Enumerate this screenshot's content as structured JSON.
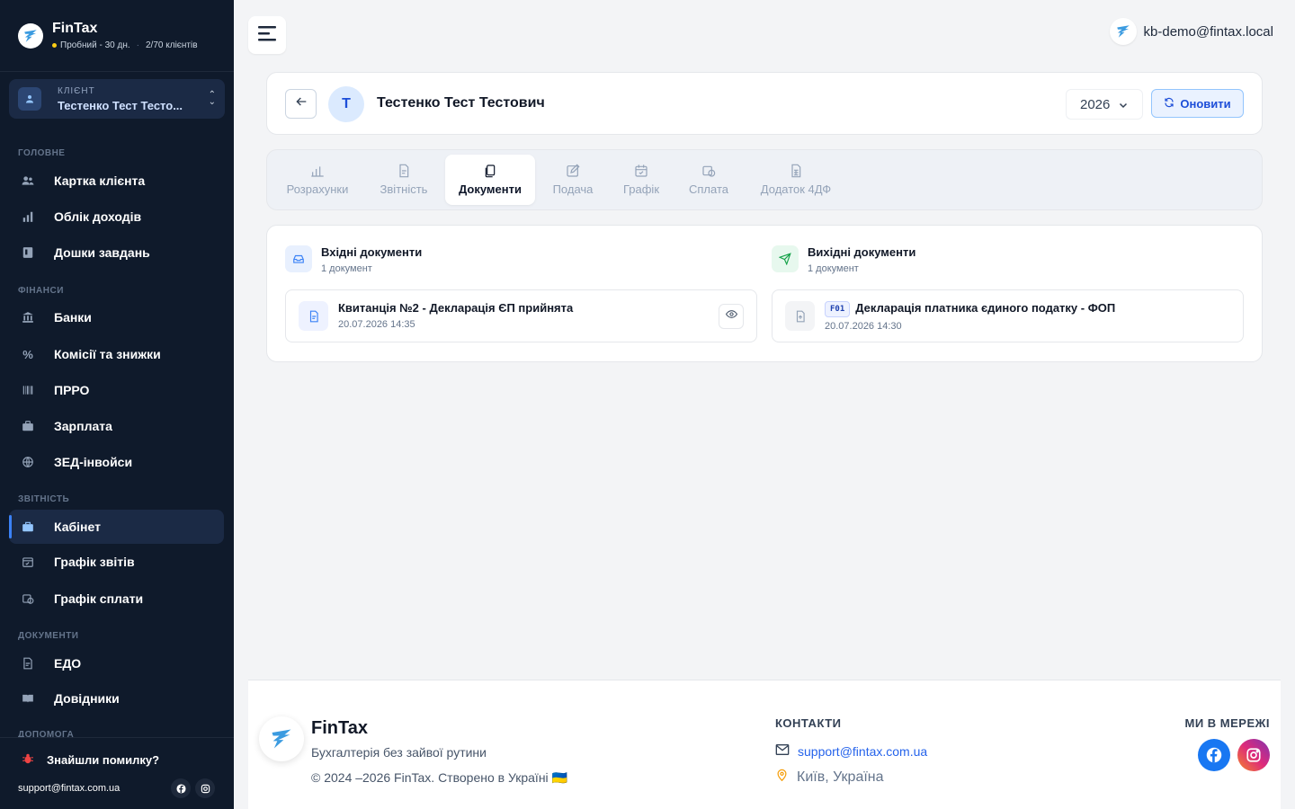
{
  "brand": {
    "name": "FinTax",
    "trial": "Пробний - 30 дн.",
    "separator": "·",
    "clients": "2/70 клієнтів"
  },
  "client_selector": {
    "kicker": "КЛІЄНТ",
    "name": "Тестенко Тест Тесто..."
  },
  "sidebar": {
    "sections": {
      "main": "ГОЛОВНЕ",
      "finance": "ФІНАНСИ",
      "reporting": "ЗВІТНІСТЬ",
      "documents": "ДОКУМЕНТИ",
      "help": "ДОПОМОГА"
    },
    "items": {
      "client_card": "Картка клієнта",
      "income": "Облік доходів",
      "boards": "Дошки завдань",
      "banks": "Банки",
      "commissions": "Комісії та знижки",
      "prro": "ПРРО",
      "salary": "Зарплата",
      "zed": "ЗЕД-інвойси",
      "cabinet": "Кабінет",
      "report_schedule": "Графік звітів",
      "payment_schedule": "Графік сплати",
      "edo": "ЕДО",
      "references": "Довідники"
    },
    "bug_report": "Знайшли помилку?",
    "support_email": "support@fintax.com.ua"
  },
  "topbar": {
    "user_email": "kb-demo@fintax.local"
  },
  "header": {
    "avatar_letter": "Т",
    "client_full_name": "Тестенко Тест Тестович",
    "year": "2026",
    "refresh_label": "Оновити"
  },
  "tabs": {
    "calculations": "Розрахунки",
    "reporting": "Звітність",
    "documents": "Документи",
    "submission": "Подача",
    "schedule": "Графік",
    "payment": "Сплата",
    "annex": "Додаток 4ДФ",
    "active": "documents"
  },
  "documents": {
    "incoming": {
      "title": "Вхідні документи",
      "count": "1 документ",
      "items": [
        {
          "title": "Квитанція №2 - Декларація ЄП прийнята",
          "date": "20.07.2026 14:35"
        }
      ]
    },
    "outgoing": {
      "title": "Вихідні документи",
      "count": "1 документ",
      "items": [
        {
          "badge": "F01",
          "title": "Декларація платника єдиного податку - ФОП",
          "date": "20.07.2026 14:30"
        }
      ]
    }
  },
  "footer": {
    "brand": "FinTax",
    "tagline": "Бухгалтерія без зайвої рутини",
    "copyright": "© 2024 –2026 FinTax. Створено в Україні 🇺🇦",
    "contacts_title": "КОНТАКТИ",
    "email": "support@fintax.com.ua",
    "location": "Київ, Україна",
    "social_title": "МИ В МЕРЕЖІ"
  },
  "colors": {
    "sidebar_bg": "#0f1a2b",
    "accent": "#3b82f6",
    "primary_text": "#1d4ed8"
  },
  "icons": [
    "menu-icon",
    "arrow-left-icon",
    "refresh-icon",
    "chevron-down-icon",
    "inbox-icon",
    "send-icon",
    "file-icon",
    "eye-icon",
    "upload-file-icon",
    "mail-icon",
    "location-pin-icon",
    "facebook-icon",
    "instagram-icon",
    "bug-icon"
  ]
}
